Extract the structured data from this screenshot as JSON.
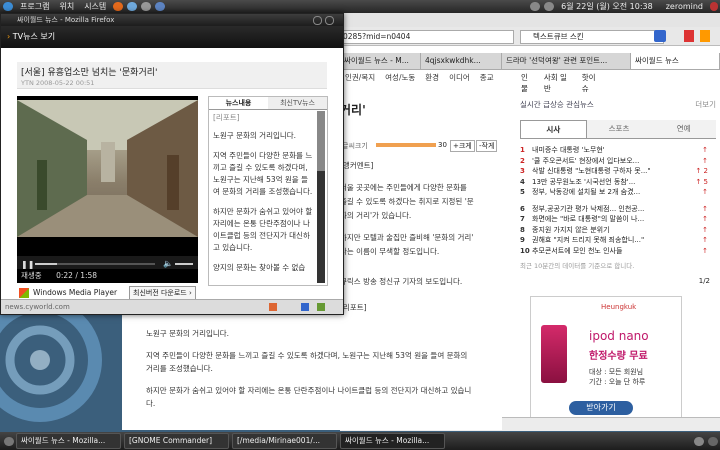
{
  "top_panel": {
    "menu": [
      "프로그램",
      "위치",
      "시스템"
    ],
    "date": "6월 22일 (월) 오전 10:38",
    "user": "zeromind"
  },
  "popup": {
    "title": "싸이월드 뉴스 - Mozilla Firefox",
    "header": "TV뉴스 보기",
    "article_title": "[서울] 유흥업소만 넘치는 '문화거리'",
    "source": "YTN 2008-05-22 00:51",
    "tabs": [
      "뉴스내용",
      "최신TV뉴스"
    ],
    "body": [
      "[리포트]",
      "노원구 문화의 거리입니다.",
      "지역 주민들이 다양한 문화를 느끼고 즐길 수 있도록 하겠다며, 노원구는 지난해 53억 원을 들여 문화의 거리를 조성했습니다.",
      "하지만 문화가 숨쉬고 있어야 할 자리에는 온통 단란주점이나 나이트클럽 등의 전단지가 대신하고 있습니다.",
      "양지의 문화는 찾아볼 수 없습"
    ],
    "status": "재생중",
    "time": "0:22 / 1:58",
    "player": "Windows Media Player",
    "download": "최신버전 다운로드 ›",
    "statusbar": "news.cyworld.com"
  },
  "bg_browser": {
    "url": "0285?mid=n0404",
    "search_placeholder": "텍스트큐브 스킨",
    "tabs": [
      "싸이월드 뉴스 - M...",
      "4qjsxkwkdhk...",
      "드라마 '선덕여왕' 관련 포인트...",
      "싸이월드 뉴스"
    ],
    "menu": [
      "인권/복지",
      "여성/노동",
      "환경",
      "이디어",
      "종교",
      "인물",
      "사회 일반",
      "핫이슈"
    ],
    "title_fragment": "거리'",
    "font_size_label": "글씨크기",
    "font_size_value": "30",
    "plus": "+크게",
    "minus": "-작게",
    "article_lines": [
      "[앵커멘트]",
      "서울 곳곳에는 주민들에게 다양한 문화를",
      "즐길 수 있도록 하겠다는 취지로 지정된 '문",
      "화의 거리'가 있습니다.",
      "하지만 모텔과 술집만 즐비해 '문화의 거리'",
      "라는 이름이 무색할 정도입니다.",
      "큐릭스 방송 정신규 기자의 보도입니다.",
      "[리포트]"
    ],
    "lower_lines": [
      "노원구 문화의 거리입니다.",
      "지역 주민들이 다양한 문화를 느끼고 즐길 수 있도록 하겠다며, 노원구는 지난해 53억 원을 들여 문화의 거리를 조성했습니다.",
      "하지만 문화가 숨쉬고 있어야 할 자리에는 온통 단란주점이나 나이트클럽 등의 전단지가 대신하고 있습니다."
    ],
    "statusbar": "news.cyworld.com"
  },
  "sidebar": {
    "title": "실시간 급상승 관심뉴스",
    "more": "더보기",
    "tabs": [
      "시사",
      "스포츠",
      "연예"
    ],
    "items": [
      {
        "rank": "1",
        "text": "내미증수 대통령 '노무현'",
        "delta": "↑"
      },
      {
        "rank": "2",
        "text": "'쿨 주오콘서트' 현장에서 입다보오...",
        "delta": "↑"
      },
      {
        "rank": "3",
        "text": "삭발 신대통령 \"노현대통령 구하자 못...\"",
        "delta": "↑ 2"
      },
      {
        "rank": "4",
        "text": "13만 공무원노조 '시국선언 동참'...",
        "delta": "↑ 5"
      },
      {
        "rank": "5",
        "text": "정부, 낙동강에 설치될 보 2개 숨겼...",
        "delta": "↑"
      },
      {
        "rank": "6",
        "text": "정부,공공기관 평가 낙제점... 인천공...",
        "delta": "↑"
      },
      {
        "rank": "7",
        "text": "화면에는 \"바로 대통령\"의 말씀이 나...",
        "delta": "↑"
      },
      {
        "rank": "8",
        "text": "종지원 가지지 않은 분위기",
        "delta": "↑"
      },
      {
        "rank": "9",
        "text": "권해효 \"지켜 드리지 못해 죄송합니...\"",
        "delta": "↑"
      },
      {
        "rank": "10",
        "text": "추모콘서트에 모인 천노 인사들",
        "delta": "↑"
      }
    ],
    "footer_note": "최근 10분간의 데이터를 기준으로 합니다.",
    "page": "1/2",
    "ad_brand": "Heungkuk",
    "ad_title": "ipod nano",
    "ad_subtitle": "한정수량 무료",
    "ad_line1": "대상 : 모든 회원님",
    "ad_line2": "기간 : 오늘 단 하루",
    "ad_button": "받아가기"
  },
  "taskbar": {
    "items": [
      "싸이월드 뉴스 - Mozilla...",
      "[GNOME Commander]",
      "[/media/Mirinae001/...",
      "싸이월드 뉴스 - Mozilla..."
    ]
  },
  "colors": {
    "accent": "#e87a00",
    "panel": "#262626",
    "red": "#cc2222"
  }
}
